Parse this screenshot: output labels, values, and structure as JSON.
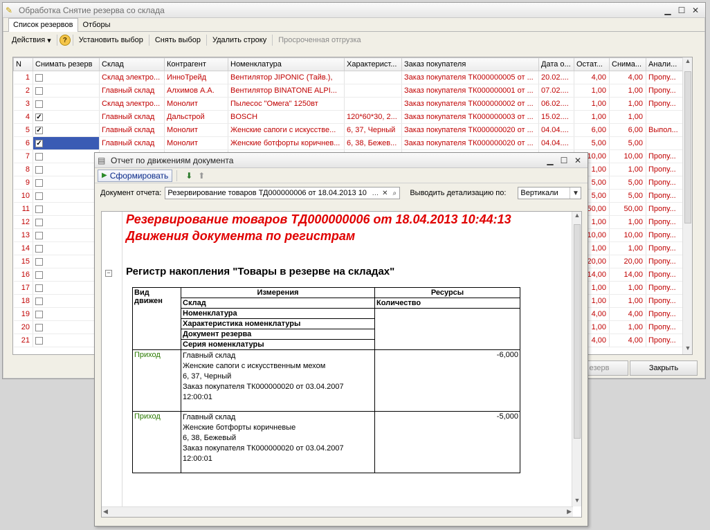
{
  "main_window": {
    "title": "Обработка  Снятие резерва со склада",
    "tabs": [
      "Список резервов",
      "Отборы"
    ],
    "toolbar": {
      "actions": "Действия",
      "set_selection": "Установить выбор",
      "clear_selection": "Снять выбор",
      "delete_row": "Удалить строку",
      "overdue": "Просроченная отгрузка"
    },
    "columns": [
      "N",
      "Снимать резерв",
      "Склад",
      "Контрагент",
      "Номенклатура",
      "Характерист...",
      "Заказ покупателя",
      "Дата о...",
      "Остат...",
      "Снима...",
      "Анали..."
    ],
    "rows": [
      {
        "n": "1",
        "checked": false,
        "warehouse": "Склад электро...",
        "partner": "ИнноТрейд",
        "item": "Вентилятор JIPONIC (Тайв.),",
        "char": "",
        "order": "Заказ покупателя ТК000000005 от ...",
        "date": "20.02....",
        "rest": "4,00",
        "remove": "4,00",
        "analysis": "Пропу..."
      },
      {
        "n": "2",
        "checked": false,
        "warehouse": "Главный склад",
        "partner": "Алхимов А.А.",
        "item": "Вентилятор BINATONE ALPI...",
        "char": "",
        "order": "Заказ покупателя ТК000000001 от ...",
        "date": "07.02....",
        "rest": "1,00",
        "remove": "1,00",
        "analysis": "Пропу..."
      },
      {
        "n": "3",
        "checked": false,
        "warehouse": "Склад электро...",
        "partner": "Монолит",
        "item": "Пылесос \"Омега\" 1250вт",
        "char": "",
        "order": "Заказ покупателя ТК000000002 от ...",
        "date": "06.02....",
        "rest": "1,00",
        "remove": "1,00",
        "analysis": "Пропу..."
      },
      {
        "n": "4",
        "checked": true,
        "warehouse": "Главный склад",
        "partner": "Дальстрой",
        "item": "BOSCH",
        "char": "120*60*30, 2...",
        "order": "Заказ покупателя ТК000000003 от ...",
        "date": "15.02....",
        "rest": "1,00",
        "remove": "1,00",
        "analysis": ""
      },
      {
        "n": "5",
        "checked": true,
        "warehouse": "Главный склад",
        "partner": "Монолит",
        "item": "Женские сапоги с искусстве...",
        "char": "6, 37, Черный",
        "order": "Заказ покупателя ТК000000020 от ...",
        "date": "04.04....",
        "rest": "6,00",
        "remove": "6,00",
        "analysis": "Выпол..."
      },
      {
        "n": "6",
        "checked": true,
        "warehouse": "Главный склад",
        "partner": "Монолит",
        "item": "Женские ботфорты коричнев...",
        "char": "6, 38, Бежев...",
        "order": "Заказ покупателя ТК000000020 от ...",
        "date": "04.04....",
        "rest": "5,00",
        "remove": "5,00",
        "analysis": ""
      },
      {
        "n": "7",
        "checked": false,
        "rest": "10,00",
        "remove": "10,00",
        "analysis": "Пропу..."
      },
      {
        "n": "8",
        "checked": false,
        "rest": "1,00",
        "remove": "1,00",
        "analysis": "Пропу..."
      },
      {
        "n": "9",
        "checked": false,
        "rest": "5,00",
        "remove": "5,00",
        "analysis": "Пропу..."
      },
      {
        "n": "10",
        "checked": false,
        "rest": "5,00",
        "remove": "5,00",
        "analysis": "Пропу..."
      },
      {
        "n": "11",
        "checked": false,
        "rest": "50,00",
        "remove": "50,00",
        "analysis": "Пропу..."
      },
      {
        "n": "12",
        "checked": false,
        "rest": "1,00",
        "remove": "1,00",
        "analysis": "Пропу..."
      },
      {
        "n": "13",
        "checked": false,
        "rest": "10,00",
        "remove": "10,00",
        "analysis": "Пропу..."
      },
      {
        "n": "14",
        "checked": false,
        "rest": "1,00",
        "remove": "1,00",
        "analysis": "Пропу..."
      },
      {
        "n": "15",
        "checked": false,
        "rest": "20,00",
        "remove": "20,00",
        "analysis": "Пропу..."
      },
      {
        "n": "16",
        "checked": false,
        "rest": "14,00",
        "remove": "14,00",
        "analysis": "Пропу..."
      },
      {
        "n": "17",
        "checked": false,
        "rest": "1,00",
        "remove": "1,00",
        "analysis": "Пропу..."
      },
      {
        "n": "18",
        "checked": false,
        "rest": "1,00",
        "remove": "1,00",
        "analysis": "Пропу..."
      },
      {
        "n": "19",
        "checked": false,
        "rest": "4,00",
        "remove": "4,00",
        "analysis": "Пропу..."
      },
      {
        "n": "20",
        "checked": false,
        "rest": "1,00",
        "remove": "1,00",
        "analysis": "Пропу..."
      },
      {
        "n": "21",
        "checked": false,
        "rest": "4,00",
        "remove": "4,00",
        "analysis": "Пропу..."
      }
    ],
    "bottom": {
      "partial_button": "езерв",
      "close_button": "Закрыть"
    }
  },
  "report_window": {
    "title": "Отчет по движениям документа",
    "generate_button": "Сформировать",
    "doc_label": "Документ отчета:",
    "doc_value": "Резервирование товаров ТД000000006 от 18.04.2013 10",
    "detail_label": "Выводить детализацию по:",
    "detail_value": "Вертикали",
    "heading1": "Резервирование товаров ТД000000006 от 18.04.2013 10:44:13",
    "heading2": "Движения документа по регистрам",
    "register_title": "Регистр накопления \"Товары в резерве на складах\"",
    "table_header": {
      "movement": "Вид движен",
      "dimensions": "Измерения",
      "resources": "Ресурсы",
      "dims": [
        "Склад",
        "Номенклатура",
        "Характеристика номенклатуры",
        "Документ резерва",
        "Серия номенклатуры"
      ],
      "qty": "Количество"
    },
    "records": [
      {
        "type": "Приход",
        "lines": [
          "Главный склад",
          "Женские сапоги с искусственным мехом",
          "6, 37, Черный",
          "Заказ покупателя ТК000000020 от 03.04.2007",
          "12:00:01"
        ],
        "qty": "-6,000"
      },
      {
        "type": "Приход",
        "lines": [
          "Главный склад",
          "Женские ботфорты коричневые",
          "6, 38, Бежевый",
          "Заказ покупателя ТК000000020 от 03.04.2007",
          "12:00:01"
        ],
        "qty": "-5,000"
      }
    ]
  },
  "colors": {
    "accent_red": "#c00000",
    "selection": "#3a5bb4",
    "heading_red": "#e00000",
    "movement_green": "#2a7a00"
  }
}
